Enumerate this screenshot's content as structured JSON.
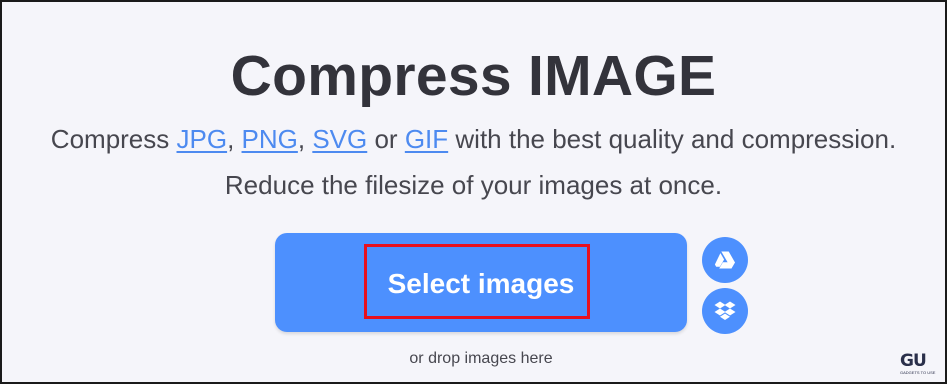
{
  "header": {
    "title": "Compress IMAGE",
    "subtitle": {
      "prefix": "Compress ",
      "links": [
        "JPG",
        "PNG",
        "SVG",
        "GIF"
      ],
      "sep1": ", ",
      "sep2": ", ",
      "sep3": " or ",
      "suffix": " with the best quality and compression.",
      "line2": "Reduce the filesize of your images at once."
    }
  },
  "upload": {
    "select_label": "Select images",
    "drop_hint": "or drop images here",
    "side_icons": [
      "google-drive-icon",
      "dropbox-icon"
    ]
  },
  "watermark": {
    "text": "GU",
    "subtext": "GADGETS TO USE"
  },
  "colors": {
    "primary": "#4d90fe",
    "link": "#4d8af0",
    "highlight": "#e8101e",
    "text": "#33333b"
  }
}
